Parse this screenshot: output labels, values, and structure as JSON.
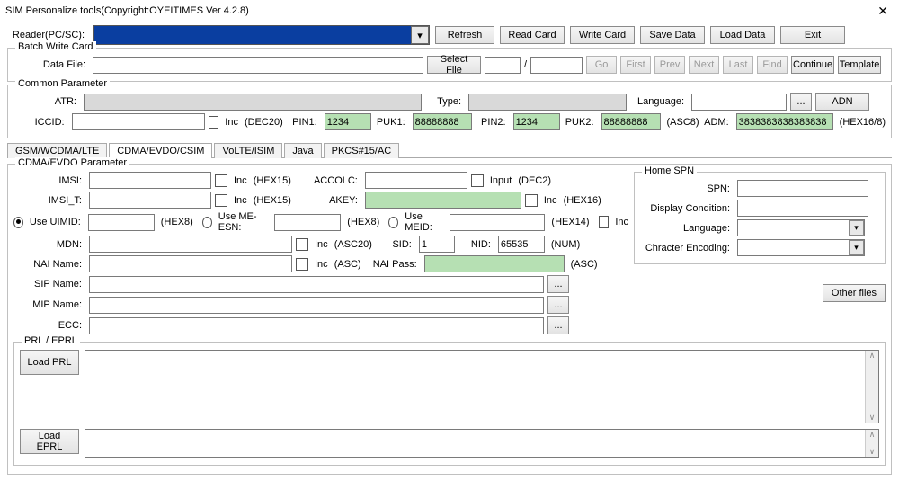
{
  "title": "SIM Personalize tools(Copyright:OYEITIMES Ver 4.2.8)",
  "reader": {
    "label": "Reader(PC/SC):",
    "buttons": [
      "Refresh",
      "Read Card",
      "Write Card",
      "Save Data",
      "Load Data",
      "Exit"
    ]
  },
  "batch": {
    "legend": "Batch Write Card",
    "datafile": "Data File:",
    "select": "Select File",
    "slash": "/",
    "go": "Go",
    "first": "First",
    "prev": "Prev",
    "next": "Next",
    "last": "Last",
    "find": "Find",
    "cont": "Continue",
    "tmpl": "Template"
  },
  "common": {
    "legend": "Common Parameter",
    "atr": "ATR:",
    "type": "Type:",
    "lang": "Language:",
    "adn": "ADN",
    "iccid": "ICCID:",
    "inc": "Inc",
    "dec20": "(DEC20)",
    "pin1": "PIN1:",
    "pin1v": "1234",
    "puk1": "PUK1:",
    "puk1v": "88888888",
    "pin2": "PIN2:",
    "pin2v": "1234",
    "puk2": "PUK2:",
    "puk2v": "88888888",
    "asc8": "(ASC8)",
    "adm": "ADM:",
    "admv": "3838383838383838",
    "hex168": "(HEX16/8)",
    "ellipsis": "..."
  },
  "tabs": [
    "GSM/WCDMA/LTE",
    "CDMA/EVDO/CSIM",
    "VoLTE/ISIM",
    "Java",
    "PKCS#15/AC"
  ],
  "cdma": {
    "legend": "CDMA/EVDO Parameter",
    "imsi": "IMSI:",
    "imsit": "IMSI_T:",
    "inc": "Inc",
    "hex15": "(HEX15)",
    "accolc": "ACCOLC:",
    "input": "Input",
    "dec2": "(DEC2)",
    "akey": "AKEY:",
    "hex16": "(HEX16)",
    "useuimid": "Use UIMID:",
    "hex8": "(HEX8)",
    "usemeesn": "Use ME-ESN:",
    "usemeid": "Use MEID:",
    "hex14": "(HEX14)",
    "mdn": "MDN:",
    "asc20": "(ASC20)",
    "sid": "SID:",
    "sidv": "1",
    "nid": "NID:",
    "nidv": "65535",
    "num": "(NUM)",
    "nai": "NAI Name:",
    "asc": "(ASC)",
    "naipass": "NAI Pass:",
    "sip": "SIP Name:",
    "mip": "MIP Name:",
    "ecc": "ECC:",
    "ellipsis": "...",
    "other": "Other files"
  },
  "spn": {
    "legend": "Home SPN",
    "spn": "SPN:",
    "disp": "Display Condition:",
    "lang": "Language:",
    "enc": "Chracter Encoding:"
  },
  "prl": {
    "legend": "PRL / EPRL",
    "loadprl": "Load PRL",
    "loadeprl": "Load EPRL"
  }
}
